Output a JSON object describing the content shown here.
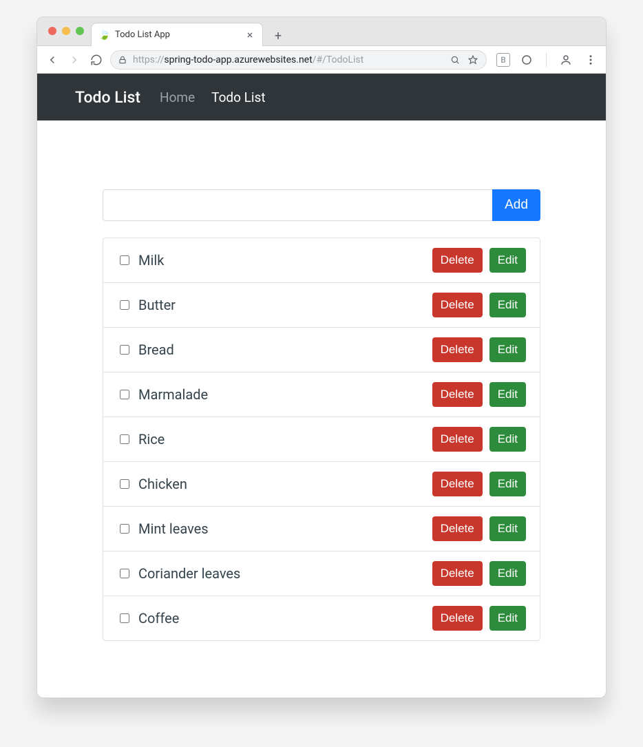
{
  "browser": {
    "tab_title": "Todo List App",
    "url_scheme": "https://",
    "url_domain": "spring-todo-app.azurewebsites.net",
    "url_path": "/#/TodoList"
  },
  "navbar": {
    "brand": "Todo List",
    "links": [
      {
        "label": "Home",
        "active": false
      },
      {
        "label": "Todo List",
        "active": true
      }
    ]
  },
  "form": {
    "input_value": "",
    "add_label": "Add"
  },
  "buttons": {
    "delete_label": "Delete",
    "edit_label": "Edit"
  },
  "items": [
    {
      "text": "Milk",
      "checked": false
    },
    {
      "text": "Butter",
      "checked": false
    },
    {
      "text": "Bread",
      "checked": false
    },
    {
      "text": "Marmalade",
      "checked": false
    },
    {
      "text": "Rice",
      "checked": false
    },
    {
      "text": "Chicken",
      "checked": false
    },
    {
      "text": "Mint leaves",
      "checked": false
    },
    {
      "text": "Coriander leaves",
      "checked": false
    },
    {
      "text": "Coffee",
      "checked": false
    }
  ]
}
